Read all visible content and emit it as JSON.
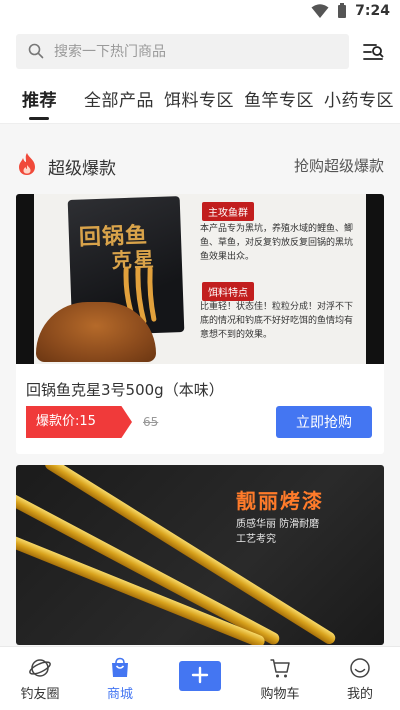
{
  "status_bar": {
    "time": "7:24"
  },
  "search": {
    "placeholder": "搜索一下热门商品"
  },
  "tabs": [
    {
      "label": "推荐",
      "active": true
    },
    {
      "label": "全部产品",
      "active": false
    },
    {
      "label": "饵料专区",
      "active": false
    },
    {
      "label": "鱼竿专区",
      "active": false
    },
    {
      "label": "小药专区",
      "active": false
    }
  ],
  "section": {
    "title": "超级爆款",
    "more_label": "抢购超级爆款"
  },
  "products": [
    {
      "title": "回锅鱼克星3号500g（本味）",
      "price_label": "爆款价:15",
      "original_price": "65",
      "buy_label": "立即抢购",
      "image": {
        "bag_title_1": "回锅鱼",
        "bag_title_2": "克星",
        "tag_1": "主攻鱼群",
        "text_1": "本产品专为黑坑，养殖水域的鲤鱼、鲫鱼、草鱼，对反复钓放反复回锅的黑坑鱼效果出众。",
        "tag_2": "饵料特点",
        "text_2": "比重轻！状态佳！粒粒分成！对浮不下底的情况和钓底不好好吃饵的鱼情均有意想不到的效果。"
      }
    },
    {
      "image": {
        "slogan": "靓丽烤漆",
        "sub_1": "质感华丽 防滑耐磨",
        "sub_2": "工艺考究"
      }
    }
  ],
  "bottom_nav": [
    {
      "label": "钓友圈",
      "icon": "planet-icon",
      "active": false
    },
    {
      "label": "商城",
      "icon": "shopping-bag-icon",
      "active": true
    },
    {
      "label": "",
      "icon": "plus-icon",
      "active": false
    },
    {
      "label": "购物车",
      "icon": "cart-icon",
      "active": false
    },
    {
      "label": "我的",
      "icon": "smiley-icon",
      "active": false
    }
  ],
  "colors": {
    "accent": "#4476f2",
    "price_red": "#f03a3a",
    "fire": "#f04a3a"
  }
}
